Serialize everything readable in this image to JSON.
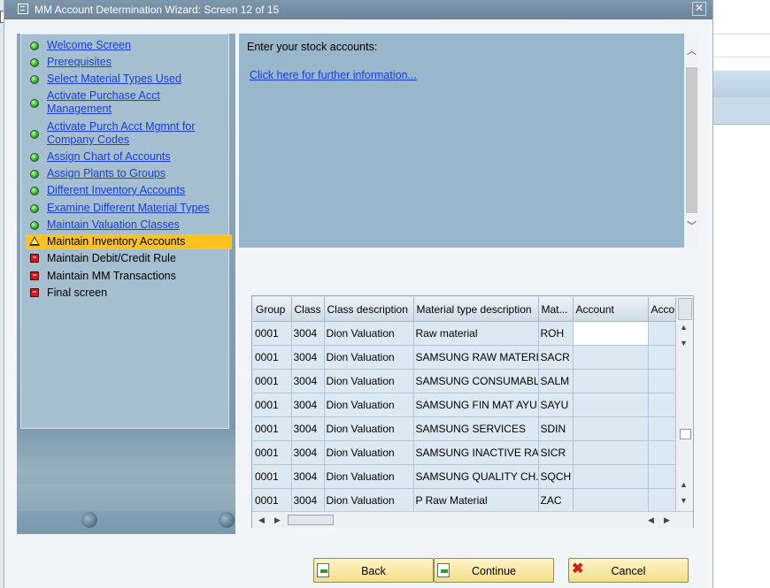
{
  "window": {
    "title": "MM Account Determination Wizard: Screen 12 of 15",
    "close_glyph": "✕"
  },
  "steps": [
    {
      "label": "Welcome Screen",
      "status": "done"
    },
    {
      "label": "Prerequisites",
      "status": "done"
    },
    {
      "label": "Select Material Types Used",
      "status": "done"
    },
    {
      "label": "Activate Purchase Acct Management",
      "status": "done"
    },
    {
      "label": "Activate Purch Acct Mgmnt for Company Codes",
      "status": "done"
    },
    {
      "label": "Assign Chart of Accounts",
      "status": "done"
    },
    {
      "label": "Assign Plants to Groups",
      "status": "done"
    },
    {
      "label": "Different Inventory Accounts",
      "status": "done"
    },
    {
      "label": "Examine Different Material Types",
      "status": "done"
    },
    {
      "label": "Maintain Valuation Classes",
      "status": "done"
    },
    {
      "label": "Maintain Inventory Accounts",
      "status": "current"
    },
    {
      "label": "Maintain Debit/Credit Rule",
      "status": "todo"
    },
    {
      "label": "Maintain MM Transactions",
      "status": "todo"
    },
    {
      "label": "Final screen",
      "status": "todo"
    }
  ],
  "info": {
    "title": "Enter your stock accounts:",
    "link": "Click here for further information..."
  },
  "table": {
    "columns": [
      "Group",
      "Class",
      "Class description",
      "Material type description",
      "Mat...",
      "Account",
      "Acco"
    ],
    "rows": [
      [
        "0001",
        "3004",
        "Dion Valuation",
        "Raw material",
        "ROH",
        "",
        ""
      ],
      [
        "0001",
        "3004",
        "Dion Valuation",
        "SAMSUNG RAW MATERI...",
        "SACR",
        "",
        ""
      ],
      [
        "0001",
        "3004",
        "Dion Valuation",
        "SAMSUNG CONSUMABL...",
        "SALM",
        "",
        ""
      ],
      [
        "0001",
        "3004",
        "Dion Valuation",
        "SAMSUNG FIN MAT AYU...",
        "SAYU",
        "",
        ""
      ],
      [
        "0001",
        "3004",
        "Dion Valuation",
        "SAMSUNG SERVICES",
        "SDIN",
        "",
        ""
      ],
      [
        "0001",
        "3004",
        "Dion Valuation",
        "SAMSUNG INACTIVE RA...",
        "SICR",
        "",
        ""
      ],
      [
        "0001",
        "3004",
        "Dion Valuation",
        "SAMSUNG QUALITY CH...",
        "SQCH",
        "",
        ""
      ],
      [
        "0001",
        "3004",
        "Dion Valuation",
        "P Raw Material",
        "ZAC",
        "",
        ""
      ]
    ]
  },
  "buttons": {
    "back": "Back",
    "continue": "Continue",
    "cancel": "Cancel"
  },
  "colors": {
    "titlebar": "#768ea5",
    "current_step": "#ffc21f",
    "link": "#1a3fd6",
    "button": "#f3de86"
  }
}
